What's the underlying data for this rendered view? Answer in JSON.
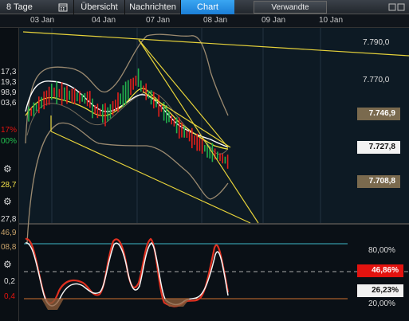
{
  "topbar": {
    "range_label": "8 Tage",
    "calendar_icon": "calendar-icon",
    "tabs": [
      "Übersicht",
      "Nachrichten",
      "Chart"
    ],
    "active_tab": "Chart",
    "related_button": "Verwandte"
  },
  "date_axis": [
    "03 Jan",
    "04 Jan",
    "07 Jan",
    "08 Jan",
    "09 Jan",
    "10 Jan"
  ],
  "left_strip": {
    "values": [
      "17,3",
      "19,3",
      "98,9",
      "03,6"
    ],
    "pct_red": "17%",
    "pct_green": "00%",
    "osc_value": "28,7",
    "lower_value": "27,8",
    "stoch_top": "46,9",
    "stoch_mid": "08,8",
    "stoch_low": "0,2",
    "stoch_min": "0,4"
  },
  "price_axis": {
    "ticks": [
      "7.790,0",
      "7.770,0"
    ],
    "markers": [
      {
        "label": "7.746,9",
        "style": "grey"
      },
      {
        "label": "7.727,8",
        "style": "white"
      },
      {
        "label": "7.708,8",
        "style": "grey"
      }
    ]
  },
  "oscillator_axis": {
    "ticks": [
      "80,00%",
      "20,00%"
    ],
    "markers": [
      {
        "label": "46,86%",
        "style": "red"
      },
      {
        "label": "26,23%",
        "style": "white"
      }
    ]
  },
  "colors": {
    "up": "#22b14c",
    "down": "#e0201a",
    "trendline": "#e6d23a",
    "ma_white": "#ffffff",
    "ma_yellow": "#f0e040",
    "band": "#9b8a70",
    "stoch_fill": "#b07040",
    "level_line": "#3fb8c8"
  },
  "chart_data": {
    "type": "candlestick",
    "instrument_range": "8 Tage",
    "x": [
      "03 Jan",
      "04 Jan",
      "07 Jan",
      "08 Jan",
      "09 Jan",
      "10 Jan"
    ],
    "price_ticks": [
      7790.0,
      7770.0
    ],
    "last_values": [
      7746.9,
      7727.8,
      7708.8
    ],
    "oscillator": {
      "type": "stochastic",
      "levels": [
        80,
        20
      ],
      "last_values": [
        46.86,
        26.23
      ]
    }
  }
}
